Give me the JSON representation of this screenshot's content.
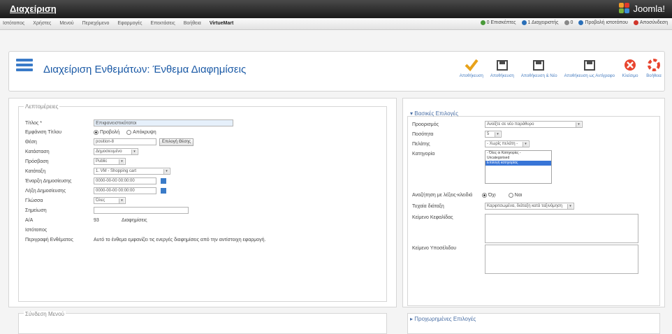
{
  "header": {
    "title": "Διαχείριση",
    "logo_text": "Joomla!"
  },
  "menubar": {
    "items": [
      "Ιστότοπος",
      "Χρήστες",
      "Μενού",
      "Περιεχόμενο",
      "Εφαρμογές",
      "Επεκτάσεις",
      "Βοήθεια",
      "VirtueMart"
    ],
    "right": [
      {
        "label": "0 Επισκέπτες",
        "color": "#4a9a3a"
      },
      {
        "label": "1 Διαχειριστής",
        "color": "#2a6fb8"
      },
      {
        "label": "0",
        "color": "#888888"
      },
      {
        "label": "Προβολή ιστοτόπου",
        "color": "#2a6fb8"
      },
      {
        "label": "Αποσύνδεση",
        "color": "#d0352b"
      }
    ]
  },
  "page": {
    "title": "Διαχείριση Ενθεμάτων: Ένθεμα Διαφημίσεις"
  },
  "toolbar": {
    "buttons": [
      {
        "label": "Αποθήκευση",
        "icon": "check-icon",
        "color": "#e8a21a"
      },
      {
        "label": "Αποθήκευση",
        "icon": "save-icon",
        "color": "#4a4a4a"
      },
      {
        "label": "Αποθήκευση & Νέο",
        "icon": "save-new-icon",
        "color": "#4a4a4a"
      },
      {
        "label": "Αποθήκευση ως Αντίγραφο",
        "icon": "save-copy-icon",
        "color": "#4a4a4a"
      },
      {
        "label": "Κλείσιμο",
        "icon": "close-icon",
        "color": "#e8452f"
      },
      {
        "label": "Βοήθεια",
        "icon": "help-icon",
        "color": "#e8452f"
      }
    ]
  },
  "details": {
    "legend": "Λεπτομέρειες",
    "fields": [
      {
        "label": "Τίτλος *",
        "value": "Επιφανειστικότατοι"
      },
      {
        "label": "Εμφάνιση Τίτλου",
        "radio": [
          "Προβολή",
          "Απόκρυψη"
        ]
      },
      {
        "label": "Θέση",
        "value": "position-8",
        "button": "Επιλογή Θέσης"
      },
      {
        "label": "Κατάσταση",
        "value": "Δημοσιευμένο"
      },
      {
        "label": "Πρόσβαση",
        "value": "Public"
      },
      {
        "label": "Κατάταξη",
        "value": "1. VM - Shopping cart"
      },
      {
        "label": "Έναρξη Δημοσίευσης",
        "value": "0000-00-00 00:00:00"
      },
      {
        "label": "Λήξη Δημοσίευσης",
        "value": "0000-00-00 00:00:00"
      },
      {
        "label": "Γλώσσα",
        "value": "Όλες"
      },
      {
        "label": "Σημείωση",
        "value": ""
      },
      {
        "label": "A/A",
        "value": "93",
        "extra": "Διαφημίσεις"
      },
      {
        "label": "Ιστότοπος",
        "value": ""
      },
      {
        "label": "Περιγραφή Ενθέματος",
        "value": "Αυτό το ένθεμα εμφανίζει τις ενεργές διαφημίσεις από την αντίστοιχη εφαρμογή."
      }
    ]
  },
  "basic": {
    "legend": "Βασικές Επιλογές",
    "fields": [
      {
        "label": "Προορισμός",
        "value": "Ανοίξτε σε νέο παράθυρο"
      },
      {
        "label": "Ποσότητα",
        "value": "5"
      },
      {
        "label": "Πελάτης",
        "value": "- Χωρίς πελάτη -"
      },
      {
        "label": "Κατηγορία",
        "list": [
          "- Όλες οι Κατηγορίες -",
          "Uncategorised",
          "Επιλογή κατηγορίας"
        ]
      },
      {
        "label": "Αναζήτηση με λέξεις-κλειδιά",
        "radio": [
          "Όχι",
          "Ναι"
        ]
      },
      {
        "label": "Τυχαία διάταξη",
        "value": "Καρφιτσωμένα, διάταξη κατά ταξινόμηση"
      },
      {
        "label": "Κείμενο Κεφαλίδας",
        "value": ""
      },
      {
        "label": "Κείμενο Υποσέλιδου",
        "value": ""
      }
    ]
  },
  "menu_assign": {
    "legend": "Σύνδεση Μενού"
  },
  "advanced": {
    "legend": "Προχωρημένες Επιλογές"
  }
}
